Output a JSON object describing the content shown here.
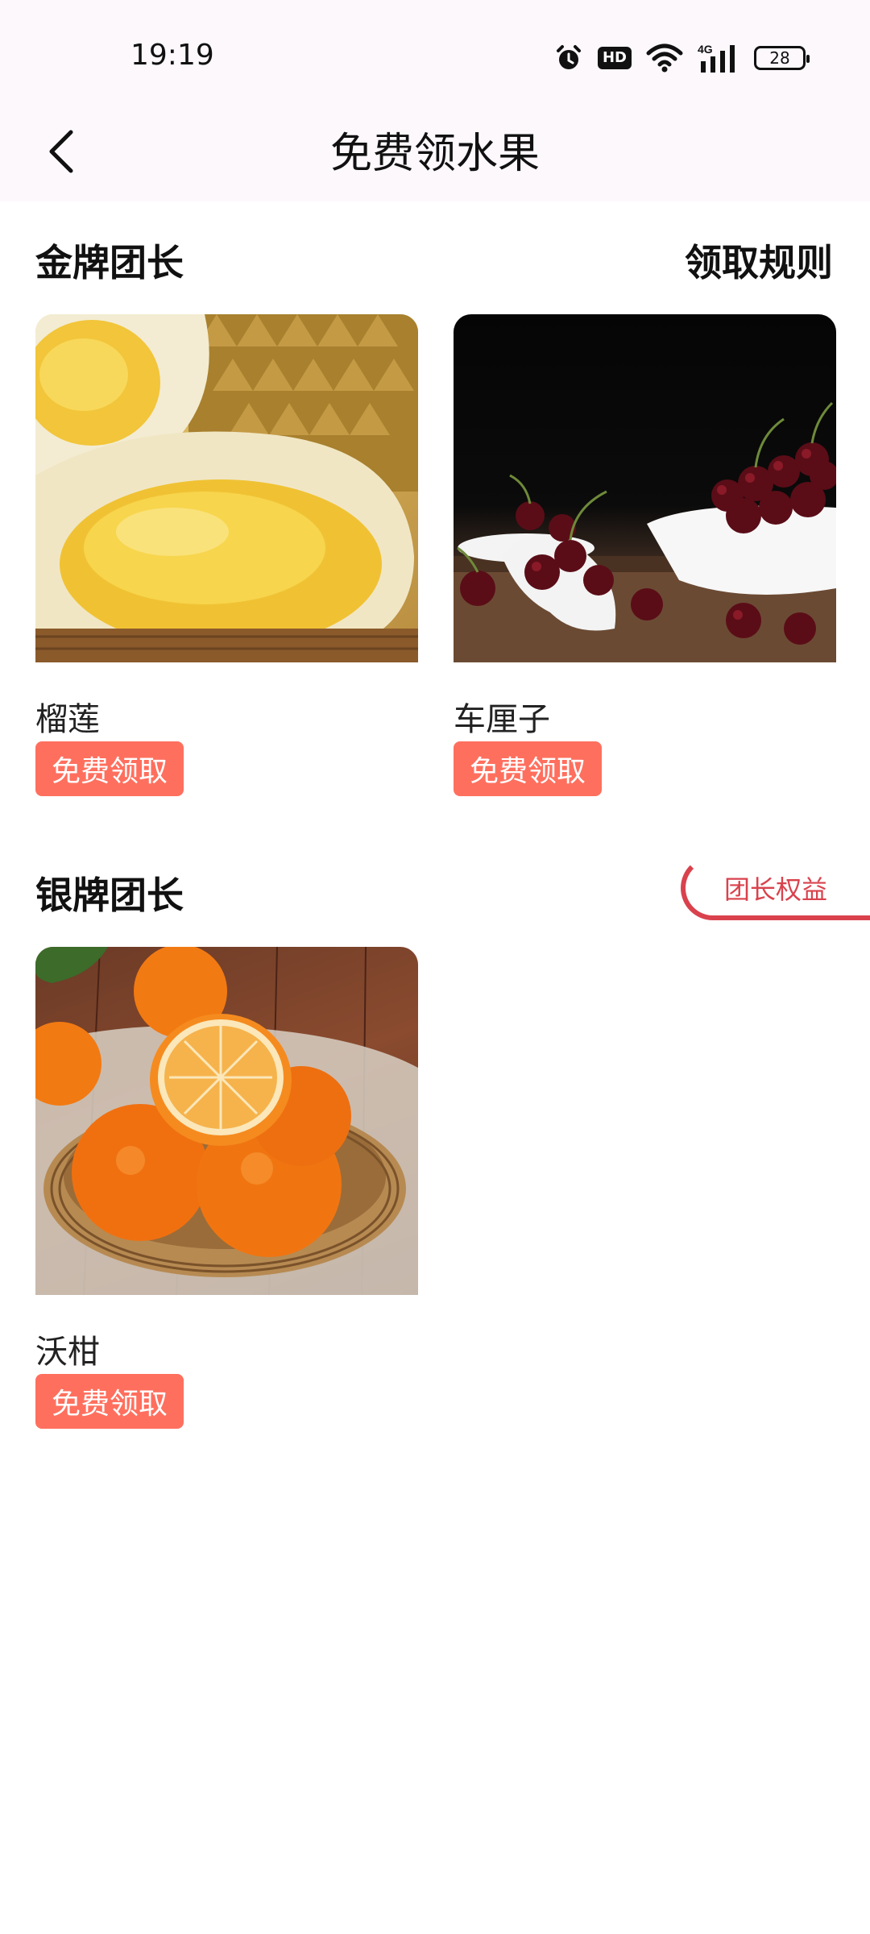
{
  "status_bar": {
    "time": "19:19",
    "hd_label": "HD",
    "network_label": "4G",
    "battery_level": "28"
  },
  "header": {
    "title": "免费领水果"
  },
  "sections": {
    "gold": {
      "title": "金牌团长",
      "rules_label": "领取规则",
      "items": [
        {
          "name": "榴莲",
          "button": "免费领取"
        },
        {
          "name": "车厘子",
          "button": "免费领取"
        }
      ]
    },
    "silver": {
      "title": "银牌团长",
      "benefit_label": "团长权益",
      "items": [
        {
          "name": "沃柑",
          "button": "免费领取"
        }
      ]
    }
  },
  "colors": {
    "accent_button": "#ff6f5e",
    "benefit_red": "#d9424d",
    "header_bg": "#fcf8fc"
  },
  "icons": {
    "back": "chevron-left-icon",
    "alarm": "alarm-icon",
    "wifi": "wifi-icon",
    "signal": "signal-icon",
    "battery": "battery-icon"
  }
}
